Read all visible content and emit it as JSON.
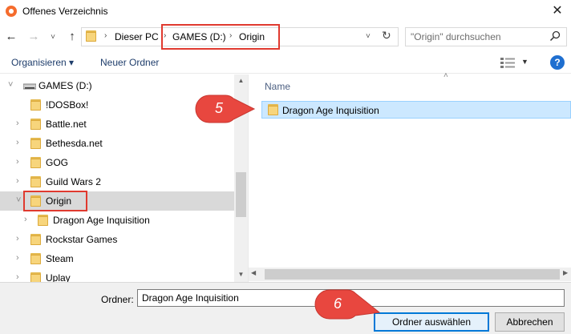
{
  "window": {
    "title": "Offenes Verzeichnis",
    "close_glyph": "✕"
  },
  "nav": {
    "back_glyph": "←",
    "forward_glyph": "→",
    "recent_glyph": "˅",
    "up_glyph": "↑",
    "breadcrumb": [
      {
        "label": "Dieser PC"
      },
      {
        "label": "GAMES (D:)"
      },
      {
        "label": "Origin"
      }
    ],
    "separator_glyph": "›",
    "dropdown_glyph": "˅",
    "refresh_glyph": "↻",
    "search_placeholder": "\"Origin\" durchsuchen"
  },
  "toolbar": {
    "organize_label": "Organisieren ▾",
    "new_folder_label": "Neuer Ordner",
    "view_dropdown_glyph": "▼",
    "help_glyph": "?"
  },
  "tree": {
    "items": [
      {
        "label": "GAMES (D:)",
        "icon": "drive-icon",
        "chev": "˅"
      },
      {
        "label": "!DOSBox!",
        "icon": "folder-icon",
        "chev": ""
      },
      {
        "label": "Battle.net",
        "icon": "folder-icon",
        "chev": "›"
      },
      {
        "label": "Bethesda.net",
        "icon": "folder-icon",
        "chev": "›"
      },
      {
        "label": "GOG",
        "icon": "folder-icon",
        "chev": "›"
      },
      {
        "label": "Guild Wars 2",
        "icon": "folder-icon",
        "chev": "›"
      },
      {
        "label": "Origin",
        "icon": "folder-icon",
        "chev": "˅",
        "selected": true
      },
      {
        "label": "Dragon Age Inquisition",
        "icon": "folder-icon",
        "chev": "›"
      },
      {
        "label": "Rockstar Games",
        "icon": "folder-icon",
        "chev": "›"
      },
      {
        "label": "Steam",
        "icon": "folder-icon",
        "chev": "›"
      },
      {
        "label": "Uplay",
        "icon": "folder-icon",
        "chev": "›"
      }
    ],
    "scroll_up_glyph": "▲",
    "scroll_down_glyph": "▼"
  },
  "content": {
    "column_name": "Name",
    "sort_glyph": "˄",
    "items": [
      {
        "label": "Dragon Age Inquisition",
        "selected": true
      }
    ],
    "scroll_left_glyph": "◀",
    "scroll_right_glyph": "▶"
  },
  "footer": {
    "folder_label": "Ordner:",
    "folder_value": "Dragon Age Inquisition",
    "select_button": "Ordner auswählen",
    "cancel_button": "Abbrechen"
  },
  "callouts": [
    {
      "number": "5",
      "color": "#e8473f"
    },
    {
      "number": "6",
      "color": "#e8473f"
    }
  ],
  "colors": {
    "highlight_red": "#e03a2f",
    "selection_blue": "#cce8ff",
    "accent_blue": "#0078d7"
  }
}
